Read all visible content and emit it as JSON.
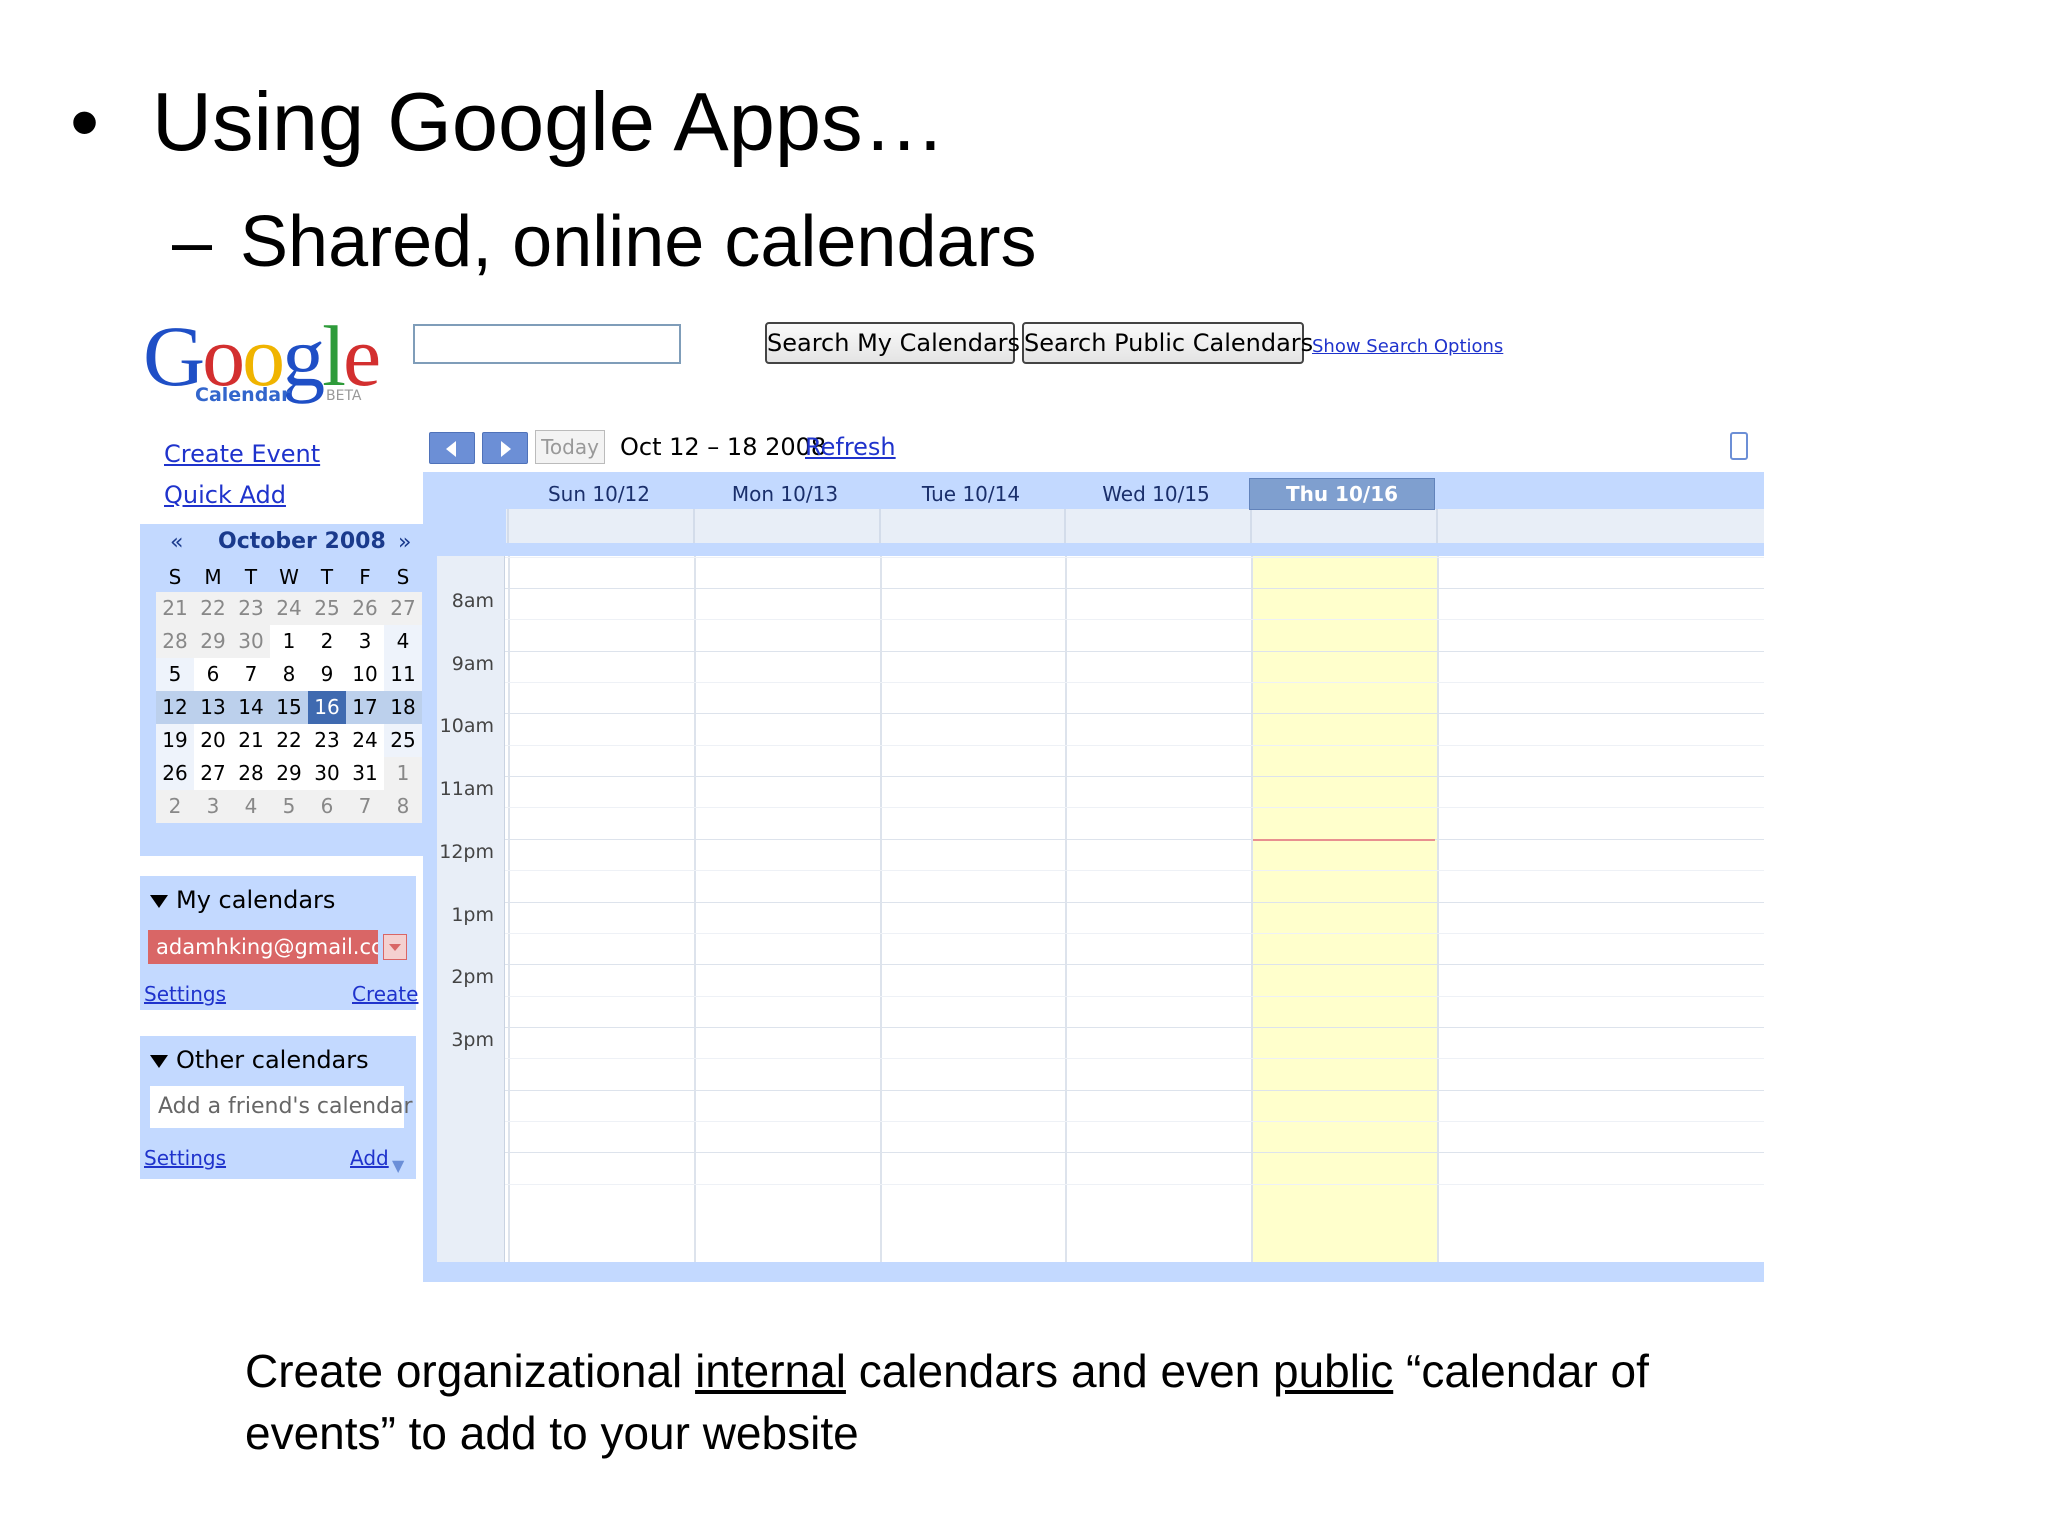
{
  "slide": {
    "bullet": "•",
    "title": "Using Google Apps…",
    "dash": "–",
    "subtitle": "Shared, online calendars",
    "caption_parts": [
      "Create organizational ",
      "internal",
      " calendars and even ",
      "public",
      " “calendar of events” to add to your website"
    ]
  },
  "gcal": {
    "logo": {
      "word": "Google",
      "sub": "Calendar",
      "beta": "BETA"
    },
    "search": {
      "value": "",
      "my_calendars_label": "Search My Calendars",
      "public_calendars_label": "Search Public Calendars",
      "options_link": "Show Search Options"
    },
    "links": {
      "create_event": "Create Event",
      "quick_add": "Quick Add"
    },
    "mini_calendar": {
      "prev": "«",
      "month": "October 2008",
      "next": "»",
      "dow": [
        "S",
        "M",
        "T",
        "W",
        "T",
        "F",
        "S"
      ],
      "weeks": [
        [
          "21",
          "22",
          "23",
          "24",
          "25",
          "26",
          "27"
        ],
        [
          "28",
          "29",
          "30",
          "1",
          "2",
          "3",
          "4"
        ],
        [
          "5",
          "6",
          "7",
          "8",
          "9",
          "10",
          "11"
        ],
        [
          "12",
          "13",
          "14",
          "15",
          "16",
          "17",
          "18"
        ],
        [
          "19",
          "20",
          "21",
          "22",
          "23",
          "24",
          "25"
        ],
        [
          "26",
          "27",
          "28",
          "29",
          "30",
          "31",
          "1"
        ],
        [
          "2",
          "3",
          "4",
          "5",
          "6",
          "7",
          "8"
        ]
      ]
    },
    "my_calendars": {
      "header": "My calendars",
      "calendar": "adamhking@gmail.com",
      "settings": "Settings",
      "create": "Create",
      "chip_color": "#d96666"
    },
    "other_calendars": {
      "header": "Other calendars",
      "placeholder": "Add a friend's calendar",
      "settings": "Settings",
      "add": "Add",
      "add_arrow": "▼"
    },
    "toolbar": {
      "today": "Today",
      "date_range": "Oct 12 – 18 2008",
      "refresh": "Refresh",
      "prev_icon": "chevron-left-icon",
      "next_icon": "chevron-right-icon",
      "print_icon": "print-icon"
    },
    "days": [
      "Sun 10/12",
      "Mon 10/13",
      "Tue 10/14",
      "Wed 10/15",
      "Thu 10/16"
    ],
    "times": [
      "8am",
      "9am",
      "10am",
      "11am",
      "12pm",
      "1pm",
      "2pm",
      "3pm"
    ],
    "colors": {
      "panel_bg": "#c3d9ff",
      "today_bg": "#ffffcc",
      "link": "#1f33cc"
    }
  }
}
